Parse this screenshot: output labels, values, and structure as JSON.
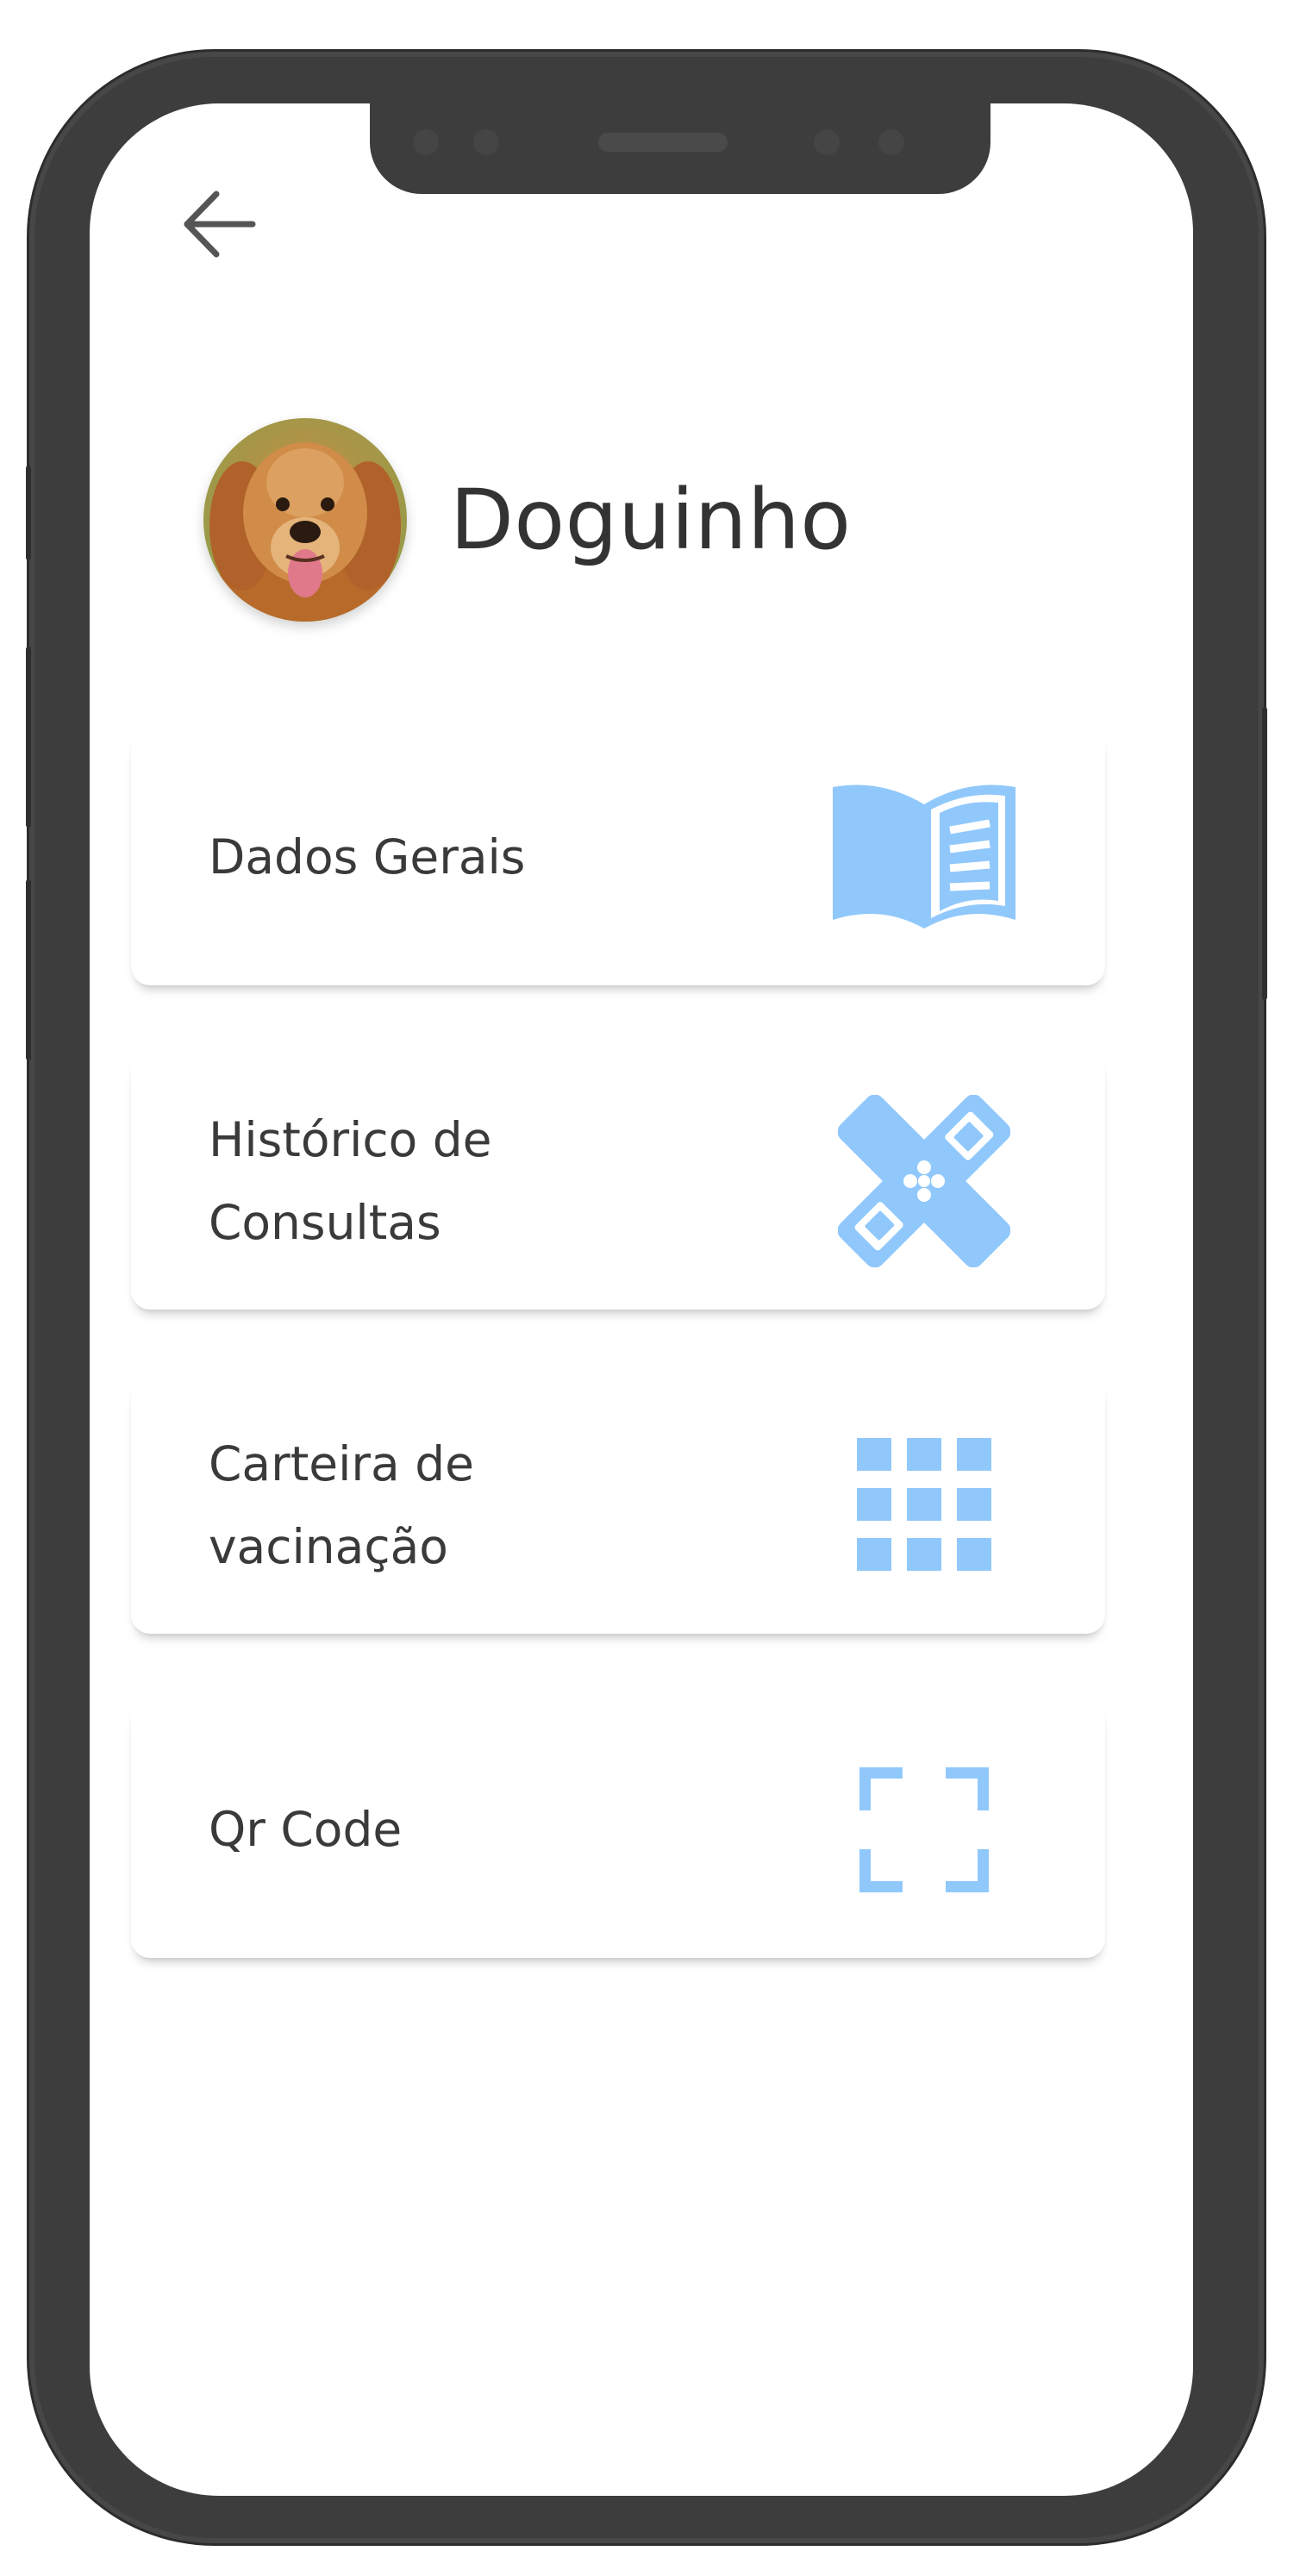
{
  "header": {
    "back_icon": "arrow-left-icon"
  },
  "profile": {
    "name": "Doguinho",
    "avatar_description_icon": "dog-avatar"
  },
  "menu": {
    "items": [
      {
        "label": "Dados Gerais",
        "icon": "open-book-icon"
      },
      {
        "label": "Histórico de\nConsultas",
        "icon": "bandage-icon"
      },
      {
        "label": "Carteira de\nvacinação",
        "icon": "grid-icon"
      },
      {
        "label": "Qr Code",
        "icon": "qr-scan-icon"
      }
    ]
  },
  "colors": {
    "accent": "#90c8fc",
    "text": "#333333",
    "frame": "#3d3d3d",
    "background": "#ffffff"
  }
}
